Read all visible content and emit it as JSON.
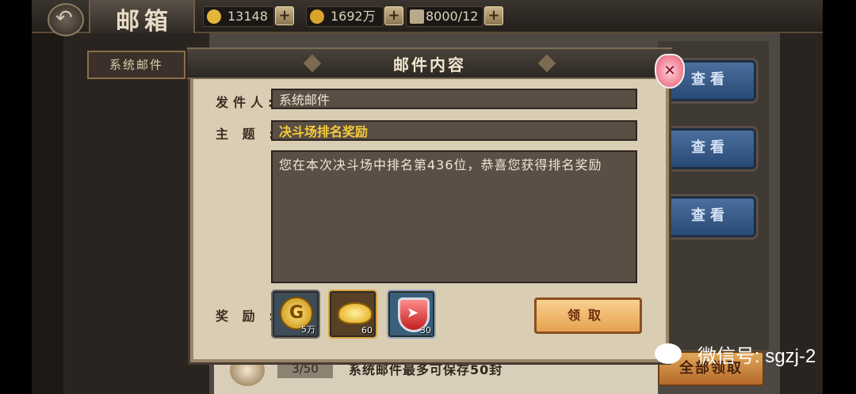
{
  "header": {
    "title": "邮箱",
    "back_icon": "back-arrow-icon"
  },
  "resources": [
    {
      "name": "ingot",
      "value": "13148",
      "color": "#e5b43a"
    },
    {
      "name": "coins",
      "value": "1692万",
      "color": "#d9a42a"
    },
    {
      "name": "stamina",
      "value": "8000/12",
      "color": "#b8a98a"
    }
  ],
  "sidebar": {
    "active_tab": "系统邮件"
  },
  "mail_list": {
    "view_label": "查看",
    "count": "3/50",
    "note": "系统邮件最多可保存50封",
    "collect_all_label": "全部领取"
  },
  "dialog": {
    "title": "邮件内容",
    "sender_label": "发件人:",
    "sender": "系统邮件",
    "subject_label": "主 题 :",
    "subject": "决斗场排名奖励",
    "body": "您在本次决斗场中排名第436位，恭喜您获得排名奖励",
    "reward_label": "奖 励 :",
    "rewards": [
      {
        "name": "coin-icon",
        "amount": "5万"
      },
      {
        "name": "gold-ingot-icon",
        "amount": "60"
      },
      {
        "name": "shield-icon",
        "amount": "30"
      }
    ],
    "claim_label": "领取",
    "close_icon": "close-icon"
  },
  "watermark": {
    "text": "微信号: sgzj-2"
  }
}
